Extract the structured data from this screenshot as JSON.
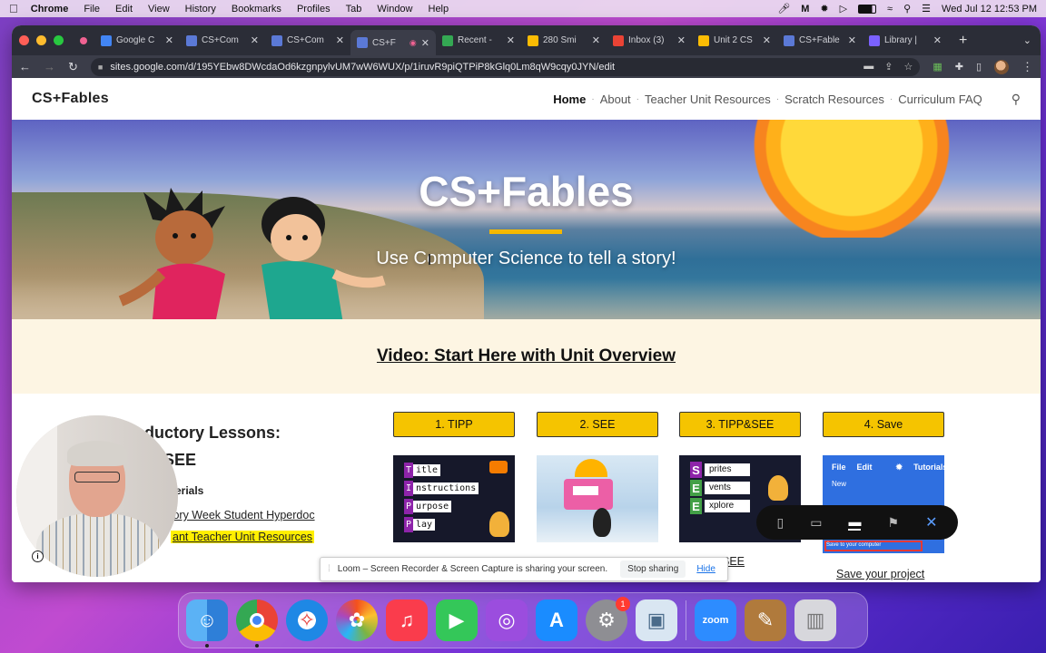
{
  "menubar": {
    "app": "Chrome",
    "items": [
      "File",
      "Edit",
      "View",
      "History",
      "Bookmarks",
      "Profiles",
      "Tab",
      "Window",
      "Help"
    ],
    "datetime": "Wed Jul 12  12:53 PM"
  },
  "tabs": [
    {
      "label": "Google C",
      "color": "#4285f4"
    },
    {
      "label": "CS+Com",
      "color": "#5b79d6"
    },
    {
      "label": "CS+Com",
      "color": "#5b79d6"
    },
    {
      "label": "CS+F",
      "color": "#5b79d6",
      "active": true
    },
    {
      "label": "Recent -",
      "color": "#34a853"
    },
    {
      "label": "280 Smi",
      "color": "#fbbc04"
    },
    {
      "label": "Inbox (3)",
      "color": "#ea4335"
    },
    {
      "label": "Unit 2 CS",
      "color": "#fbbc04"
    },
    {
      "label": "CS+Fable",
      "color": "#5b79d6"
    },
    {
      "label": "Library |",
      "color": "#7b61ff"
    }
  ],
  "address": {
    "url": "sites.google.com/d/195YEbw8DWcdaOd6kzgnpylvUM7wW6WUX/p/1iruvR9piQTPiP8kGlq0Lm8qW9cqy0JYN/edit"
  },
  "site": {
    "brand": "CS+Fables",
    "nav": [
      {
        "label": "Home",
        "active": true
      },
      {
        "label": "About"
      },
      {
        "label": "Teacher Unit Resources"
      },
      {
        "label": "Scratch Resources"
      },
      {
        "label": "Curriculum FAQ"
      }
    ],
    "hero_title": "CS+Fables",
    "hero_subtitle": "Use Computer Science to tell a story!",
    "accent": "#f5b800",
    "video_link": "Video: Start Here with Unit Overview",
    "lessons_heading_1": "oductory Lessons:",
    "lessons_heading_2": "SEE",
    "materials_label": "erials",
    "link_hyperdoc": "tory Week Student Hyperdoc",
    "link_teacher": "ant Teacher Unit Resources",
    "buttons": [
      "1. TIPP",
      "2. SEE",
      "3. TIPP&SEE",
      "4. Save"
    ],
    "tipp_acronym": [
      {
        "letter": "T",
        "word": "itle",
        "color": "#8e24aa"
      },
      {
        "letter": "I",
        "word": "nstructions",
        "color": "#8e24aa"
      },
      {
        "letter": "P",
        "word": "urpose",
        "color": "#8e24aa"
      },
      {
        "letter": "P",
        "word": "lay",
        "color": "#8e24aa"
      }
    ],
    "see_acronym": [
      {
        "letter": "S",
        "word": "prites",
        "color": "#8e24aa"
      },
      {
        "letter": "E",
        "word": "vents",
        "color": "#43a047"
      },
      {
        "letter": "E",
        "word": "xplore",
        "color": "#43a047"
      }
    ],
    "save_thumb": {
      "file": "File",
      "edit": "Edit",
      "tutorials": "Tutorials",
      "new": "New",
      "save": "Save to your computer"
    },
    "tippsee_link": "PP&SEE",
    "save_link": "Save your project"
  },
  "share_bar": {
    "message": "Loom – Screen Recorder & Screen Capture is sharing your screen.",
    "stop": "Stop sharing",
    "hide": "Hide"
  },
  "dock": {
    "apps": [
      {
        "name": "finder-icon",
        "glyph": "☺",
        "bg": "#3f9cf0"
      },
      {
        "name": "chrome-icon",
        "glyph": "◉",
        "bg": "#ffffff"
      },
      {
        "name": "safari-icon",
        "glyph": "✧",
        "bg": "#1e88e5"
      },
      {
        "name": "photos-icon",
        "glyph": "✿",
        "bg": "#ffffff"
      },
      {
        "name": "music-icon",
        "glyph": "♫",
        "bg": "#fa3c4c"
      },
      {
        "name": "facetime-icon",
        "glyph": "▶",
        "bg": "#34c759"
      },
      {
        "name": "podcasts-icon",
        "glyph": "◎",
        "bg": "#9b4dde"
      },
      {
        "name": "appstore-icon",
        "glyph": "A",
        "bg": "#1a8cff"
      },
      {
        "name": "settings-icon",
        "glyph": "⚙",
        "bg": "#8e8e93"
      },
      {
        "name": "preview-icon",
        "glyph": "▣",
        "bg": "#d9e6f2"
      },
      {
        "name": "zoom-icon",
        "glyph": "zoom",
        "bg": "#2d8cff"
      },
      {
        "name": "notes-icon",
        "glyph": "✎",
        "bg": "#b07a3c"
      },
      {
        "name": "trash-icon",
        "glyph": "▥",
        "bg": "#d7d7dc"
      }
    ],
    "settings_badge": "1"
  }
}
